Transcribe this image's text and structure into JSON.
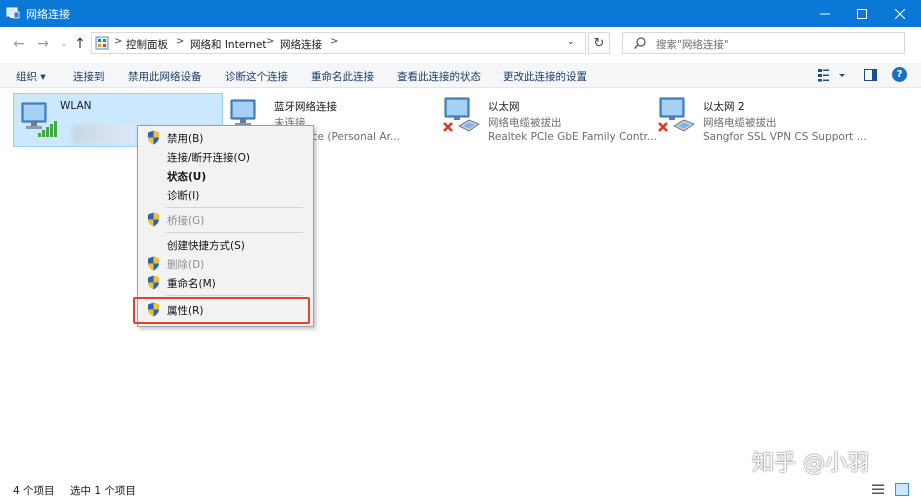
{
  "window": {
    "title": "网络连接",
    "buttons": {
      "minimize": "—",
      "maximize": "☐",
      "close": "✕"
    }
  },
  "addressbar": {
    "back": "←",
    "forward": "→",
    "recent": "⌄",
    "up": "↑",
    "breadcrumbs": [
      "控制面板",
      "网络和 Internet",
      "网络连接"
    ],
    "separator": ">",
    "dropdown": "⌄",
    "refresh": "↻",
    "search_placeholder": "搜索\"网络连接\""
  },
  "commandbar": {
    "items": [
      "组织 ▾",
      "连接到",
      "禁用此网络设备",
      "诊断这个连接",
      "重命名此连接",
      "查看此连接的状态",
      "更改此连接的设置"
    ],
    "view_dropdown": "▾",
    "help": "?"
  },
  "connections": [
    {
      "name": "WLAN",
      "status": "",
      "device": "",
      "icon": "wifi-adapter-icon",
      "selected": true
    },
    {
      "name": "蓝牙网络连接",
      "status": "未连接",
      "device": "th Device (Personal Ar...",
      "icon": "bluetooth-adapter-icon",
      "selected": false
    },
    {
      "name": "以太网",
      "status": "网络电缆被拔出",
      "device": "Realtek PCIe GbE Family Contr...",
      "icon": "ethernet-adapter-icon",
      "selected": false
    },
    {
      "name": "以太网 2",
      "status": "网络电缆被拔出",
      "device": "Sangfor SSL VPN CS Support ...",
      "icon": "ethernet-adapter-icon",
      "selected": false
    }
  ],
  "context_menu": {
    "items": [
      {
        "label": "禁用(B)",
        "shield": true,
        "disabled": false,
        "bold": false
      },
      {
        "label": "连接/断开连接(O)",
        "shield": false,
        "disabled": false,
        "bold": false
      },
      {
        "label": "状态(U)",
        "shield": false,
        "disabled": false,
        "bold": true
      },
      {
        "label": "诊断(I)",
        "shield": false,
        "disabled": false,
        "bold": false
      },
      {
        "label": "桥接(G)",
        "shield": true,
        "disabled": true,
        "bold": false
      },
      {
        "label": "创建快捷方式(S)",
        "shield": false,
        "disabled": false,
        "bold": false
      },
      {
        "label": "删除(D)",
        "shield": true,
        "disabled": true,
        "bold": false
      },
      {
        "label": "重命名(M)",
        "shield": true,
        "disabled": false,
        "bold": false
      },
      {
        "label": "属性(R)",
        "shield": true,
        "disabled": false,
        "bold": false
      }
    ],
    "highlight_color": "#e0442c"
  },
  "statusbar": {
    "item_count": "4 个项目",
    "selected": "选中 1 个项目"
  },
  "watermark": "知乎 @小羽",
  "colors": {
    "titlebar": "#0b78d7",
    "selection": "#cce8ff",
    "command_text": "#1e3d6b"
  }
}
